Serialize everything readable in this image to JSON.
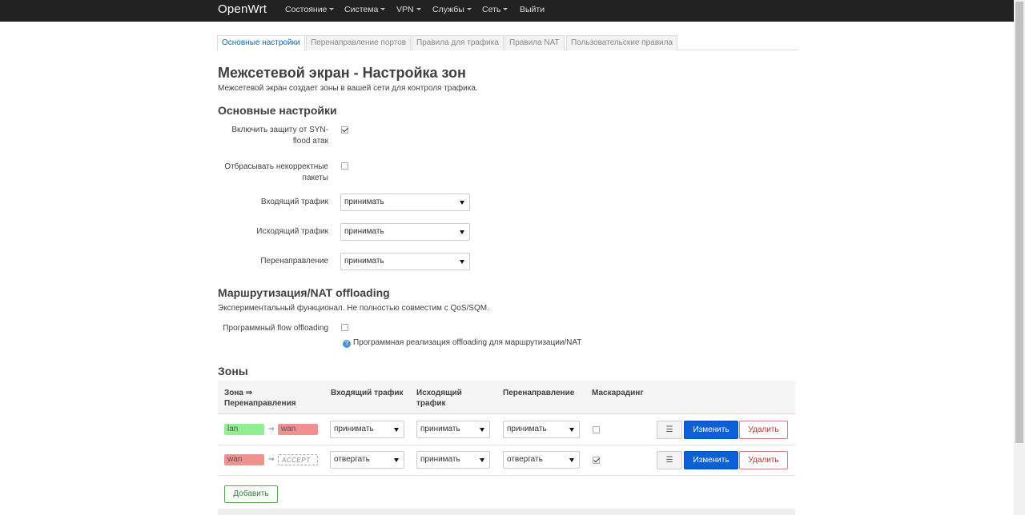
{
  "nav": {
    "brand": "OpenWrt",
    "items": [
      "Состояние",
      "Система",
      "VPN",
      "Службы",
      "Сеть",
      "Выйти"
    ]
  },
  "tabs": [
    "Основные настройки",
    "Перенаправление портов",
    "Правила для трафика",
    "Правила NAT",
    "Пользовательские правила"
  ],
  "page": {
    "title": "Межсетевой экран - Настройка зон",
    "description": "Межсетевой экран создает зоны в вашей сети для контроля трафика."
  },
  "general": {
    "heading": "Основные настройки",
    "syn_label_1": "Включить защиту от SYN-",
    "syn_label_2": "flood атак",
    "syn_checked": true,
    "invalid_label_1": "Отбрасывать некорректные",
    "invalid_label_2": "пакеты",
    "invalid_checked": false,
    "input_label": "Входящий трафик",
    "input_value": "принимать",
    "output_label": "Исходящий трафик",
    "output_value": "принимать",
    "forward_label": "Перенаправление",
    "forward_value": "принимать"
  },
  "offload": {
    "heading": "Маршрутизация/NAT offloading",
    "description": "Экспериментальный функционал. Не полностью совместим с QoS/SQM.",
    "sw_label": "Программный flow offloading",
    "sw_checked": false,
    "sw_help": "Программная реализация offloading для маршрутизации/NAT"
  },
  "zones": {
    "heading": "Зоны",
    "headers": {
      "zone_1": "Зона ⇒",
      "zone_2": "Перенаправления",
      "input": "Входящий трафик",
      "output_1": "Исходящий",
      "output_2": "трафик",
      "forward": "Перенаправление",
      "masq": "Маскарадинг"
    },
    "rows": [
      {
        "zone": "lan",
        "arrow": "⇒",
        "dest": "wan",
        "input": "принимать",
        "output": "принимать",
        "forward": "принимать",
        "masq": false
      },
      {
        "zone": "wan",
        "arrow": "⇒",
        "dest": "ACCEPT",
        "input": "отвергать",
        "output": "принимать",
        "forward": "отвергать",
        "masq": true
      }
    ],
    "menu_icon": "☰",
    "edit_label": "Изменить",
    "delete_label": "Удалить",
    "add_label": "Добавить"
  },
  "colors": {
    "navbar": "#222222",
    "lan": "#90f090",
    "wan": "#f09090",
    "primary": "#0d5fd6"
  }
}
